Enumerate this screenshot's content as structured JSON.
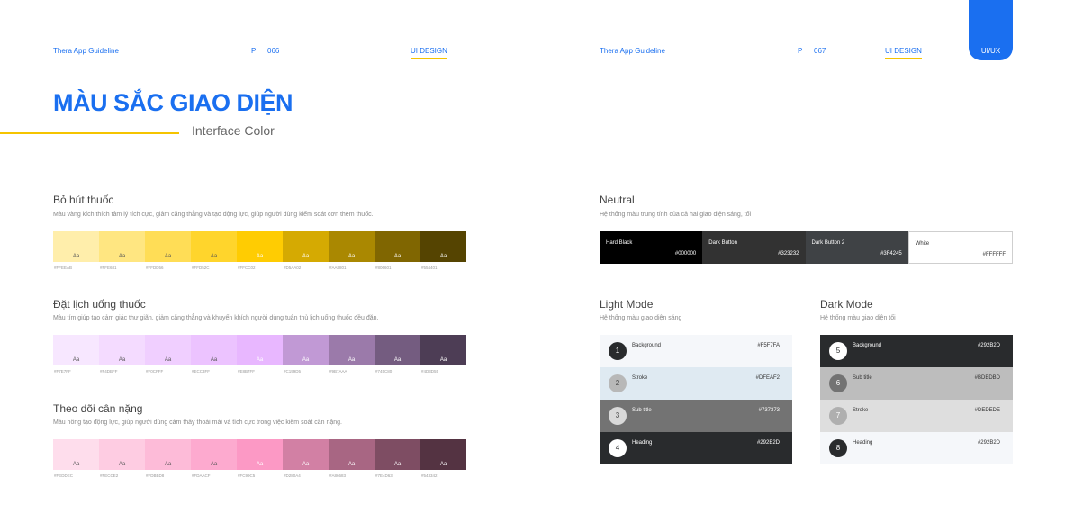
{
  "header": {
    "left": {
      "brand": "Thera App Guideline",
      "p": "P",
      "page": "066",
      "section": "UI DESIGN"
    },
    "right": {
      "brand": "Thera App Guideline",
      "p": "P",
      "page": "067",
      "section": "UI DESIGN"
    },
    "corner": "UI/UX"
  },
  "title": {
    "main": "MÀU SẮC GIAO DIỆN",
    "sub": "Interface Color"
  },
  "groups": [
    {
      "title": "Bỏ hút thuốc",
      "desc": "Màu vàng kích thích tâm lý tích cực, giảm căng thẳng và tạo động lực, giúp người dùng kiểm soát cơn thèm thuốc.",
      "sample": "Aa",
      "swatches": [
        {
          "hex": "#FFEEAB",
          "color": "#FFEEAB",
          "text": "#555555"
        },
        {
          "hex": "#FFE681",
          "color": "#FFE681",
          "text": "#555555"
        },
        {
          "hex": "#FFDD56",
          "color": "#FFDD56",
          "text": "#555555"
        },
        {
          "hex": "#FFD52C",
          "color": "#FFD52C",
          "text": "#555555"
        },
        {
          "hex": "#FFCC02",
          "color": "#FFCC02",
          "text": "#ffffff"
        },
        {
          "hex": "#D5AA02",
          "color": "#D5AA02",
          "text": "#ffffff"
        },
        {
          "hex": "#AA8801",
          "color": "#AA8801",
          "text": "#ffffff"
        },
        {
          "hex": "#806601",
          "color": "#806601",
          "text": "#ffffff"
        },
        {
          "hex": "#554401",
          "color": "#554401",
          "text": "#ffffff"
        }
      ]
    },
    {
      "title": "Đặt lịch uống thuốc",
      "desc": "Màu tím giúp tạo cảm giác thư giãn, giảm căng thẳng và khuyến khích người dùng tuân thủ lịch uống thuốc đều đặn.",
      "sample": "Aa",
      "swatches": [
        {
          "hex": "#F7E7FF",
          "color": "#F7E7FF",
          "text": "#555555"
        },
        {
          "hex": "#F4DBFF",
          "color": "#F4DBFF",
          "text": "#555555"
        },
        {
          "hex": "#F0CFFF",
          "color": "#F0CFFF",
          "text": "#555555"
        },
        {
          "hex": "#ECC3FF",
          "color": "#ECC3FF",
          "text": "#555555"
        },
        {
          "hex": "#E8B7FF",
          "color": "#E8B7FF",
          "text": "#ffffff"
        },
        {
          "hex": "#C199D5",
          "color": "#C199D5",
          "text": "#ffffff"
        },
        {
          "hex": "#9B7AAA",
          "color": "#9B7AAA",
          "text": "#ffffff"
        },
        {
          "hex": "#745C80",
          "color": "#745C80",
          "text": "#ffffff"
        },
        {
          "hex": "#4D3D55",
          "color": "#4D3D55",
          "text": "#ffffff"
        }
      ]
    },
    {
      "title": "Theo dõi cân nặng",
      "desc": "Màu hồng tạo động lực, giúp người dùng cảm thấy thoải mái và tích cực trong việc kiểm soát cân nặng.",
      "sample": "Aa",
      "swatches": [
        {
          "hex": "#FEDDEC",
          "color": "#FEDDEC",
          "text": "#555555"
        },
        {
          "hex": "#FECCE2",
          "color": "#FECCE2",
          "text": "#555555"
        },
        {
          "hex": "#FDBBD8",
          "color": "#FDBBD8",
          "text": "#555555"
        },
        {
          "hex": "#FDAACF",
          "color": "#FDAACF",
          "text": "#555555"
        },
        {
          "hex": "#FC99C5",
          "color": "#FC99C5",
          "text": "#ffffff"
        },
        {
          "hex": "#D280A4",
          "color": "#D280A4",
          "text": "#ffffff"
        },
        {
          "hex": "#A86683",
          "color": "#A86683",
          "text": "#ffffff"
        },
        {
          "hex": "#7E4D63",
          "color": "#7E4D63",
          "text": "#ffffff"
        },
        {
          "hex": "#543342",
          "color": "#543342",
          "text": "#ffffff"
        }
      ]
    }
  ],
  "neutral": {
    "title": "Neutral",
    "desc": "Hệ thống màu trung tính của cả hai giao diện sáng, tối",
    "items": [
      {
        "name": "Hard Black",
        "hex": "#000000",
        "color": "#000000",
        "text": "#ffffff"
      },
      {
        "name": "Dark Button",
        "hex": "#323232",
        "color": "#323232",
        "text": "#ffffff"
      },
      {
        "name": "Dark Button 2",
        "hex": "#3F4245",
        "color": "#3F4245",
        "text": "#ffffff"
      },
      {
        "name": "White",
        "hex": "#FFFFFF",
        "color": "#FFFFFF",
        "text": "#333333"
      }
    ]
  },
  "light_mode": {
    "title": "Light Mode",
    "desc": "Hệ thống màu giao diện sáng",
    "items": [
      {
        "num": "1",
        "name": "Background",
        "hex": "#F5F7FA",
        "color": "#F5F7FA",
        "text": "#333333",
        "circle": "#292B2D",
        "circle_text": "#ffffff"
      },
      {
        "num": "2",
        "name": "Stroke",
        "hex": "#DFEAF2",
        "color": "#DFEAF2",
        "text": "#333333",
        "circle": "#B8B8B8",
        "circle_text": "#444444"
      },
      {
        "num": "3",
        "name": "Sub title",
        "hex": "#737373",
        "color": "#737373",
        "text": "#ffffff",
        "circle": "#D9D9D9",
        "circle_text": "#444444"
      },
      {
        "num": "4",
        "name": "Heading",
        "hex": "#292B2D",
        "color": "#292B2D",
        "text": "#ffffff",
        "circle": "#FFFFFF",
        "circle_text": "#292B2D"
      }
    ]
  },
  "dark_mode": {
    "title": "Dark Mode",
    "desc": "Hệ thống màu giao diện tối",
    "items": [
      {
        "num": "5",
        "name": "Background",
        "hex": "#292B2D",
        "color": "#292B2D",
        "text": "#ffffff",
        "circle": "#FFFFFF",
        "circle_text": "#292B2D"
      },
      {
        "num": "6",
        "name": "Sub title",
        "hex": "#BDBDBD",
        "color": "#BDBDBD",
        "text": "#333333",
        "circle": "#737373",
        "circle_text": "#ffffff"
      },
      {
        "num": "7",
        "name": "Stroke",
        "hex": "#DEDEDE",
        "color": "#DEDEDE",
        "text": "#333333",
        "circle": "#AFAFAF",
        "circle_text": "#ffffff"
      },
      {
        "num": "8",
        "name": "Heading",
        "hex": "#292B2D",
        "color": "#F5F7FA",
        "text": "#333333",
        "circle": "#292B2D",
        "circle_text": "#ffffff"
      }
    ]
  }
}
